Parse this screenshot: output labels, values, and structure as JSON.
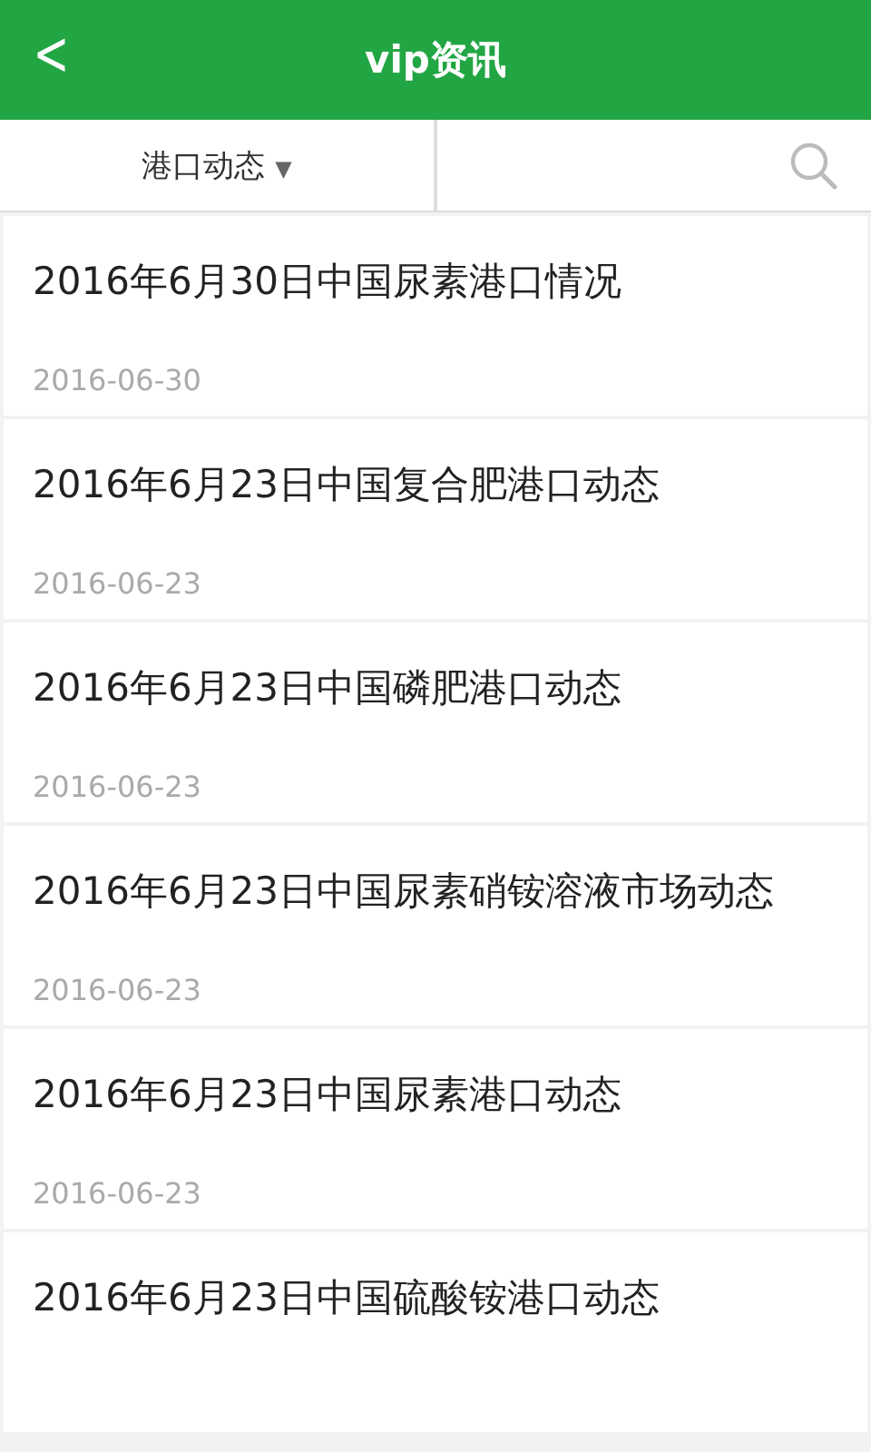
{
  "header": {
    "back": "<",
    "title": "vip资讯"
  },
  "filter": {
    "label": "港口动态",
    "caret": "▼"
  },
  "articles": [
    {
      "title": "2016年6月30日中国尿素港口情况",
      "date": "2016-06-30"
    },
    {
      "title": "2016年6月23日中国复合肥港口动态",
      "date": "2016-06-23"
    },
    {
      "title": "2016年6月23日中国磷肥港口动态",
      "date": "2016-06-23"
    },
    {
      "title": "2016年6月23日中国尿素硝铵溶液市场动态",
      "date": "2016-06-23"
    },
    {
      "title": "2016年6月23日中国尿素港口动态",
      "date": "2016-06-23"
    },
    {
      "title": "2016年6月23日中国硫酸铵港口动态"
    }
  ]
}
